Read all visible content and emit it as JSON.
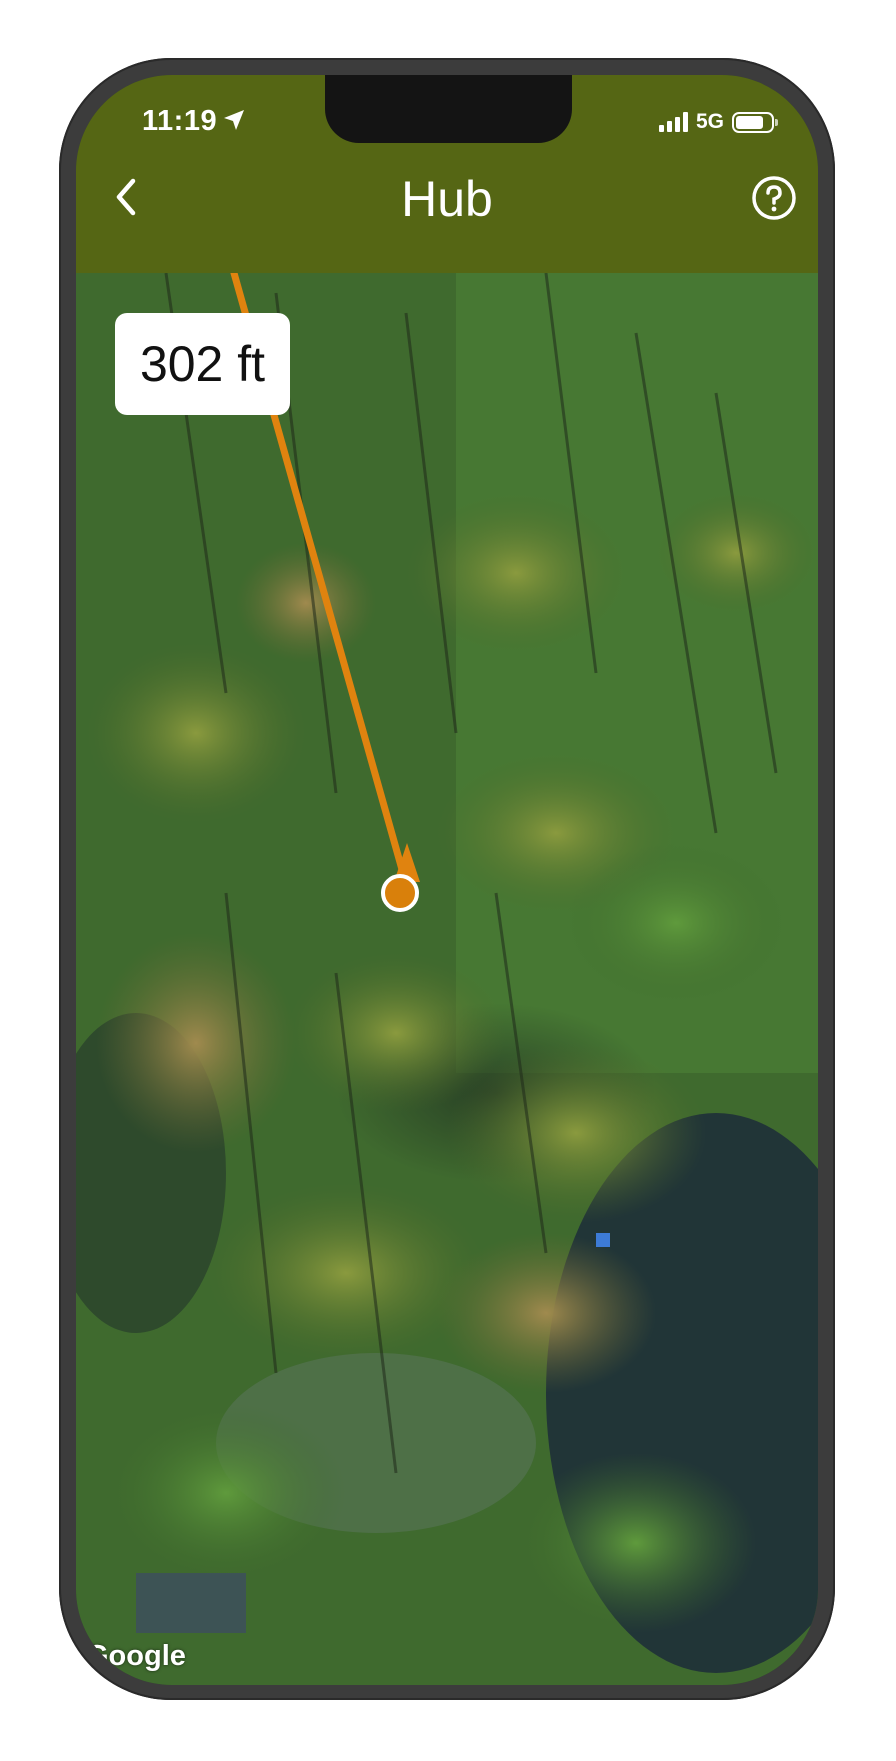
{
  "status_bar": {
    "time": "11:19",
    "network": "5G",
    "signal_level": 4,
    "battery_level": 0.8,
    "location_icon": "location-arrow-icon"
  },
  "nav": {
    "back_icon": "chevron-left-icon",
    "title": "Hub",
    "help_icon": "question-circle-icon"
  },
  "map": {
    "distance_label": "302 ft",
    "attribution": "Google",
    "imagery": "satellite-forest",
    "route_color": "#E0830F",
    "marker_color": "#D9800B",
    "marker_border": "#FFFFFF"
  },
  "colors": {
    "header_bg": "#556614",
    "frame": "#3C3C3C"
  }
}
